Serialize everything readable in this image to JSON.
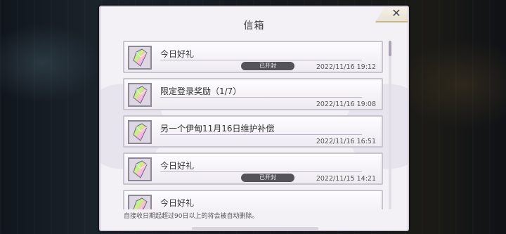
{
  "dialog": {
    "title": "信箱",
    "close_label": "✕",
    "footer_note": "自接收日期起超过90日以上的将会被自动删除。"
  },
  "mails": [
    {
      "name": "今日好礼",
      "badge": "已开封",
      "time": "2022/11/16 19:12"
    },
    {
      "name": "限定登录奖励（1/7）",
      "badge": "",
      "time": "2022/11/16 19:08"
    },
    {
      "name": "另一个伊甸11月16日维护补偿",
      "badge": "",
      "time": "2022/11/16 16:51"
    },
    {
      "name": "今日好礼",
      "badge": "已开封",
      "time": "2022/11/15 14:21"
    },
    {
      "name": "今日好礼",
      "badge": "",
      "time": ""
    }
  ],
  "scroll": {
    "position_fraction": 0.0
  }
}
